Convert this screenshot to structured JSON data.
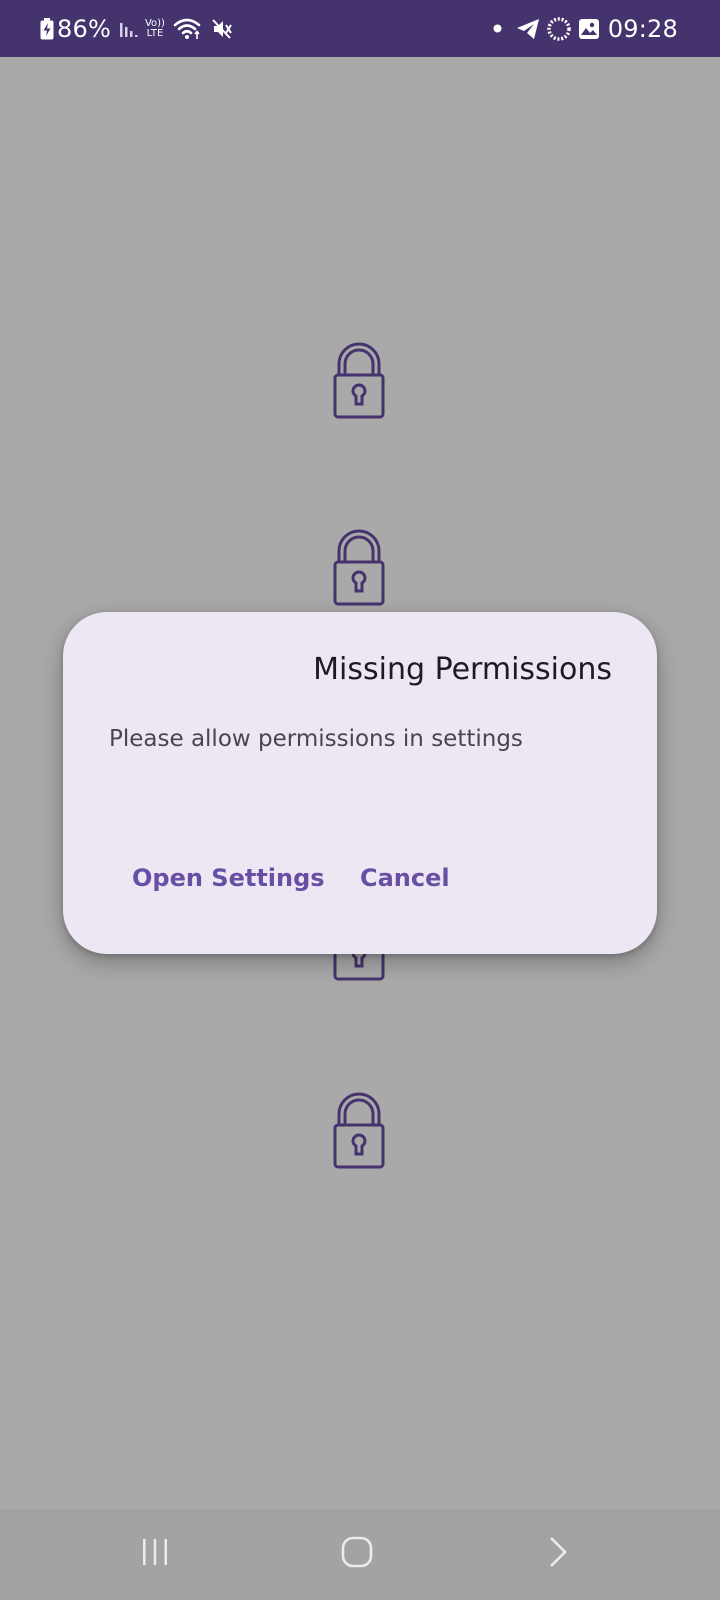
{
  "status_bar": {
    "battery_percent": "86%",
    "time": "09:28",
    "icons_left": [
      "battery-charging-icon",
      "signal-bars-icon",
      "volte-lte-icon",
      "wifi-icon",
      "mute-icon"
    ],
    "volte_label_top": "Vo))",
    "volte_label_bottom": "LTE",
    "icons_right": [
      "notification-dot-icon",
      "telegram-icon",
      "sync-ring-icon",
      "gallery-icon"
    ]
  },
  "background": {
    "lock_icons": [
      "lock-icon",
      "lock-icon",
      "lock-icon",
      "lock-icon"
    ]
  },
  "dialog": {
    "title": "Missing Permissions",
    "message": "Please allow permissions in settings",
    "open_settings_label": "Open Settings",
    "cancel_label": "Cancel"
  },
  "nav_bar": {
    "buttons": [
      "recents-icon",
      "home-icon",
      "back-icon"
    ]
  },
  "colors": {
    "status_bar": "#45336e",
    "scrim": "#aaa9aa",
    "dialog_surface": "#ede6f3",
    "accent": "#6750a4",
    "lock_stroke": "#45336e"
  }
}
